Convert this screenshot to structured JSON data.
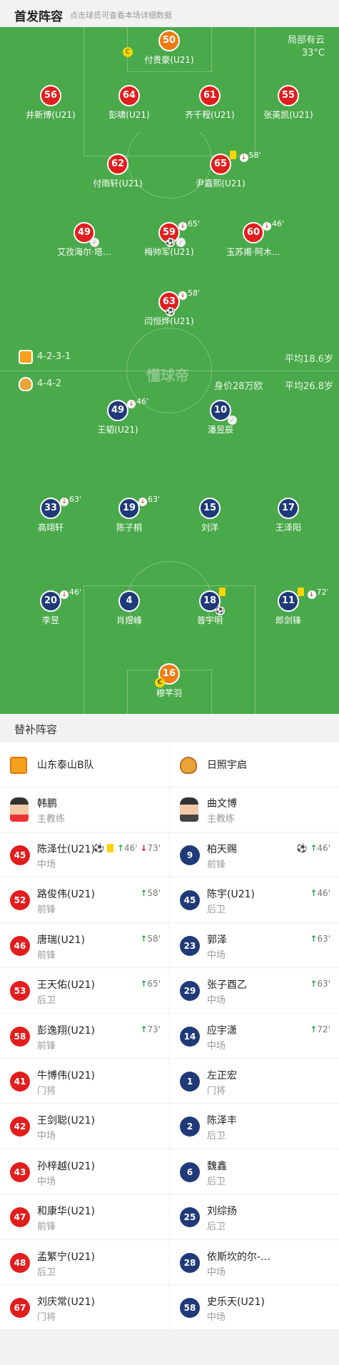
{
  "header": {
    "title": "首发阵容",
    "hint": "点击球员可查看本场详细数据"
  },
  "weather": {
    "condition": "局部有云",
    "temp": "33°C"
  },
  "home": {
    "formation": "4-2-3-1",
    "avg_age": "平均18.6岁",
    "name": "山东泰山B队",
    "coach": "韩鹏",
    "coach_role": "主教练"
  },
  "away": {
    "formation": "4-4-2",
    "value": "身价28万欧",
    "avg_age": "平均26.8岁",
    "name": "日照宇启",
    "coach": "曲文博",
    "coach_role": "主教练"
  },
  "logo_text": "懂球帝",
  "captain_mark": "C",
  "icons": {
    "sub_out": "red-down-arrow-icon",
    "sub_in": "green-up-arrow-icon",
    "goal": "ball-icon",
    "assist": "shoe-icon",
    "yellow": "yellow-card-icon"
  },
  "home_players": [
    {
      "num": "50",
      "name": "付贵豪(U21)",
      "gk": true,
      "captain": true
    },
    {
      "num": "56",
      "name": "井新博(U21)"
    },
    {
      "num": "64",
      "name": "彭啸(U21)"
    },
    {
      "num": "61",
      "name": "齐千程(U21)"
    },
    {
      "num": "55",
      "name": "张英凯(U21)"
    },
    {
      "num": "62",
      "name": "付雨轩(U21)"
    },
    {
      "num": "65",
      "name": "尹嘉熙(U21)",
      "ev": "58'"
    },
    {
      "num": "49",
      "name": "艾孜海尔·塔…"
    },
    {
      "num": "59",
      "name": "梅帅军(U21)",
      "ev": "65'"
    },
    {
      "num": "60",
      "name": "玉苏甫·阿木…",
      "ev": "46'"
    },
    {
      "num": "63",
      "name": "闫恒烨(U21)",
      "ev": "58'"
    }
  ],
  "away_players": [
    {
      "num": "49",
      "name": "王韬(U21)",
      "ev": "46'"
    },
    {
      "num": "10",
      "name": "潘昱辰"
    },
    {
      "num": "33",
      "name": "高翊轩",
      "ev": "63'"
    },
    {
      "num": "19",
      "name": "陈子桐",
      "ev": "63'"
    },
    {
      "num": "15",
      "name": "刘洋"
    },
    {
      "num": "17",
      "name": "王泽阳"
    },
    {
      "num": "20",
      "name": "李昱",
      "ev": "46'"
    },
    {
      "num": "4",
      "name": "肖煜峰"
    },
    {
      "num": "18",
      "name": "普宇明"
    },
    {
      "num": "11",
      "name": "郎剑锋",
      "ev": "72'"
    },
    {
      "num": "16",
      "name": "穆芊羽",
      "gk": true,
      "captain": true
    }
  ],
  "subs_title": "替补阵容",
  "home_subs": [
    {
      "num": "45",
      "name": "陈泽仕(U21)",
      "pos": "中场",
      "ev_in": "46'",
      "ev_out": "73'"
    },
    {
      "num": "52",
      "name": "路俊伟(U21)",
      "pos": "前锋",
      "ev_in": "58'"
    },
    {
      "num": "46",
      "name": "唐瑞(U21)",
      "pos": "前锋",
      "ev_in": "58'"
    },
    {
      "num": "53",
      "name": "王天佑(U21)",
      "pos": "后卫",
      "ev_in": "65'"
    },
    {
      "num": "58",
      "name": "彭逸翔(U21)",
      "pos": "前锋",
      "ev_in": "73'"
    },
    {
      "num": "41",
      "name": "牛博伟(U21)",
      "pos": "门将"
    },
    {
      "num": "42",
      "name": "王剑聪(U21)",
      "pos": "中场"
    },
    {
      "num": "43",
      "name": "孙梓越(U21)",
      "pos": "中场"
    },
    {
      "num": "47",
      "name": "和康华(U21)",
      "pos": "前锋"
    },
    {
      "num": "48",
      "name": "孟繁宁(U21)",
      "pos": "后卫"
    },
    {
      "num": "67",
      "name": "刘庆常(U21)",
      "pos": "门将"
    }
  ],
  "away_subs": [
    {
      "num": "9",
      "name": "柏天赐",
      "pos": "前锋",
      "ev_in": "46'"
    },
    {
      "num": "45",
      "name": "陈宇(U21)",
      "pos": "后卫",
      "ev_in": "46'"
    },
    {
      "num": "23",
      "name": "郭泽",
      "pos": "中场",
      "ev_in": "63'"
    },
    {
      "num": "29",
      "name": "张子酉乙",
      "pos": "中场",
      "ev_in": "63'"
    },
    {
      "num": "14",
      "name": "应宇潇",
      "pos": "中场",
      "ev_in": "72'"
    },
    {
      "num": "1",
      "name": "左正宏",
      "pos": "门将"
    },
    {
      "num": "2",
      "name": "陈泽丰",
      "pos": "后卫"
    },
    {
      "num": "6",
      "name": "魏鑫",
      "pos": "后卫"
    },
    {
      "num": "25",
      "name": "刘综扬",
      "pos": "后卫"
    },
    {
      "num": "28",
      "name": "依斯坎的尔-…",
      "pos": "中场"
    },
    {
      "num": "58",
      "name": "史乐天(U21)",
      "pos": "中场"
    }
  ]
}
